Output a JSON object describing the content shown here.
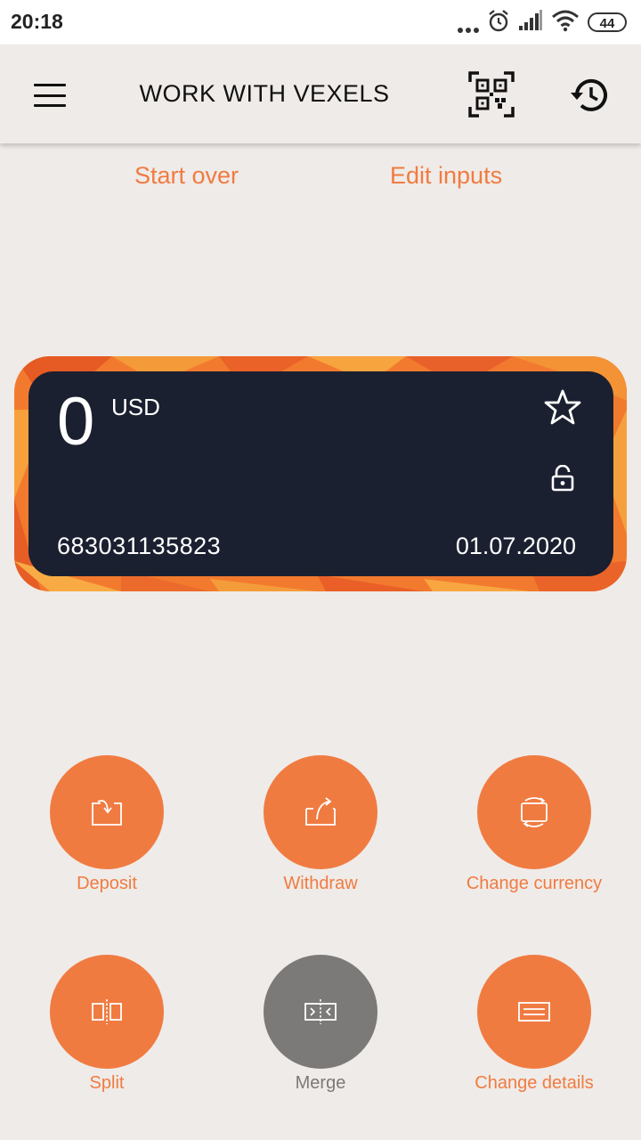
{
  "status_bar": {
    "time": "20:18",
    "battery": "44"
  },
  "app_bar": {
    "title": "WORK WITH VEXELS",
    "icons": [
      "menu-icon",
      "qr-code-icon",
      "history-icon"
    ]
  },
  "links": {
    "start_over": "Start over",
    "edit_inputs": "Edit inputs"
  },
  "card": {
    "amount": "0",
    "currency": "USD",
    "number": "683031135823",
    "date": "01.07.2020",
    "icons": [
      "star-icon",
      "unlock-icon"
    ]
  },
  "actions": [
    {
      "label": "Deposit",
      "icon": "deposit-icon"
    },
    {
      "label": "Withdraw",
      "icon": "withdraw-icon"
    },
    {
      "label": "Change currency",
      "icon": "change-currency-icon"
    },
    {
      "label": "Split",
      "icon": "split-icon"
    },
    {
      "label": "Merge",
      "icon": "merge-icon",
      "disabled": true
    },
    {
      "label": "Change details",
      "icon": "change-details-icon"
    }
  ],
  "colors": {
    "accent": "#f07b41",
    "card_bg": "#1b2030",
    "background": "#efebe8",
    "disabled": "#7c7a78"
  }
}
